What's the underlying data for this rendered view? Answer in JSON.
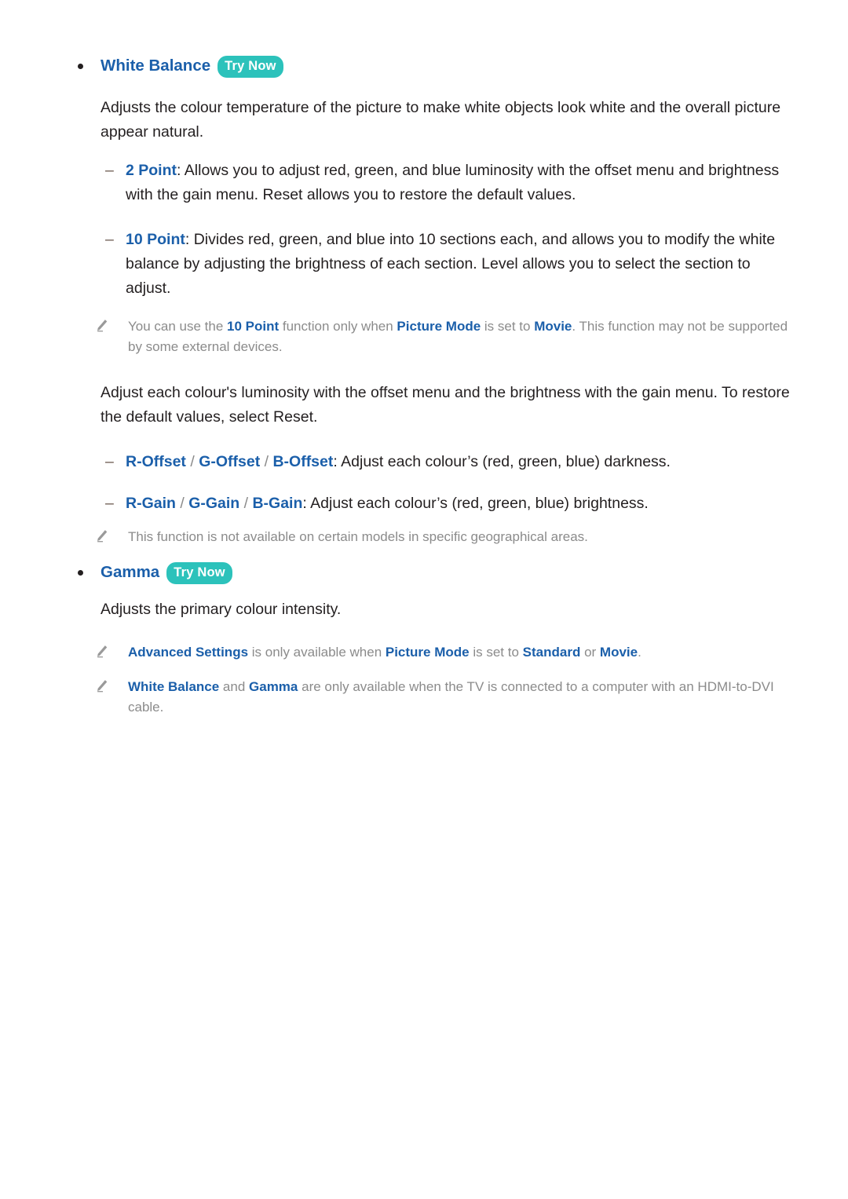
{
  "colors": {
    "heading_blue": "#1b5faa",
    "body_dark": "#231f20",
    "note_gray": "#8b8b8b",
    "badge_teal": "#2cc2bb",
    "dash_brown": "#6d5b51"
  },
  "sections": [
    {
      "heading": "White Balance",
      "badge": "Try Now",
      "paragraph": "Adjusts the colour temperature of the picture to make white objects look white and the overall picture appear natural.",
      "items": [
        {
          "term": "2 Point",
          "colon": ":",
          "text": " Allows you to adjust red, green, and blue luminosity with the offset menu and brightness with the gain menu. Reset allows you to restore the default values."
        },
        {
          "term": "10 Point",
          "colon": ":",
          "text": " Divides red, green, and blue into 10 sections each, and allows you to modify the white balance by adjusting the brightness of each section. Level allows you to select the section to adjust."
        }
      ],
      "note1": {
        "icon": "pencil-icon",
        "t1": "You can use the ",
        "k1": "10 Point",
        "t2": " function only when ",
        "k2": "Picture Mode",
        "t3": " is set to ",
        "k3": "Movie",
        "t4": ". This function may not be supported by some external devices."
      },
      "paragraph2": "Adjust each colour's luminosity with the offset menu and the brightness with the gain menu. To restore the default values, select Reset.",
      "offset_item": {
        "k1": "R-Offset",
        "s1": " / ",
        "k2": "G-Offset",
        "s2": " / ",
        "k3": "B-Offset",
        "text": ": Adjust each colour’s (red, green, blue) darkness."
      },
      "gain_item": {
        "k1": "R-Gain",
        "s1": " / ",
        "k2": "G-Gain",
        "s2": " / ",
        "k3": "B-Gain",
        "text": ": Adjust each colour’s (red, green, blue) brightness."
      },
      "note2": {
        "icon": "pencil-icon",
        "text": "This function is not available on certain models in specific geographical areas."
      }
    },
    {
      "heading": "Gamma",
      "badge": "Try Now",
      "paragraph": "Adjusts the primary colour intensity."
    }
  ],
  "footer_notes": [
    {
      "icon": "pencil-icon",
      "t1": "",
      "k1": "Advanced Settings",
      "t2": " is only available when ",
      "k2": "Picture Mode",
      "t3": " is set to ",
      "k3": "Standard",
      "t4": " or ",
      "k4": "Movie",
      "t5": "."
    },
    {
      "icon": "pencil-icon",
      "t1": "",
      "k1": "White Balance",
      "t2": " and ",
      "k2": "Gamma",
      "t3": " are only available when the TV is connected to a computer with an HDMI-to-DVI cable.",
      "k3": "",
      "t4": "",
      "k4": "",
      "t5": ""
    }
  ]
}
